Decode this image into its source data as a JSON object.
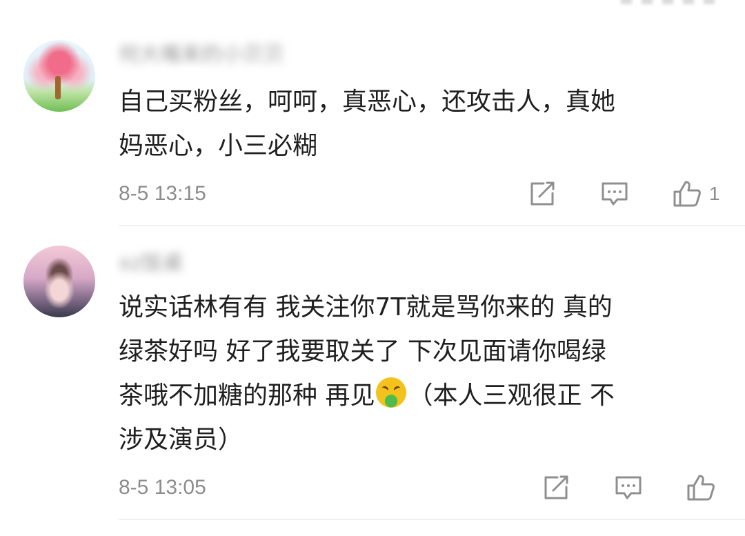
{
  "comments": [
    {
      "username": "何大嘴来的小贝贝",
      "content": "自己买粉丝，呵呵，真恶心，还攻击人，真她\n妈恶心，小三必糊",
      "timestamp": "8-5 13:15",
      "like_count": "1",
      "avatar_icon": "avatar-blossom-tree"
    },
    {
      "username": "xz饭桌",
      "content_before_emoji": "说实话林有有 我关注你7T就是骂你来的 真的\n绿茶好吗 好了我要取关了 下次见面请你喝绿\n茶哦不加糖的那种 再见",
      "content_after_emoji": "（本人三观很正 不\n涉及演员）",
      "emoji_icon": "nauseated-face-icon",
      "timestamp": "8-5 13:05",
      "like_count": "",
      "avatar_icon": "avatar-girl-photo"
    }
  ],
  "icons": {
    "share": "share-edit-icon",
    "reply": "comment-bubble-icon",
    "like": "thumbs-up-icon"
  },
  "colors": {
    "text_primary": "#1f1f1f",
    "text_secondary": "#8c8c8c",
    "divider": "#e6e6e6",
    "icon_stroke": "#8f8f8f"
  }
}
